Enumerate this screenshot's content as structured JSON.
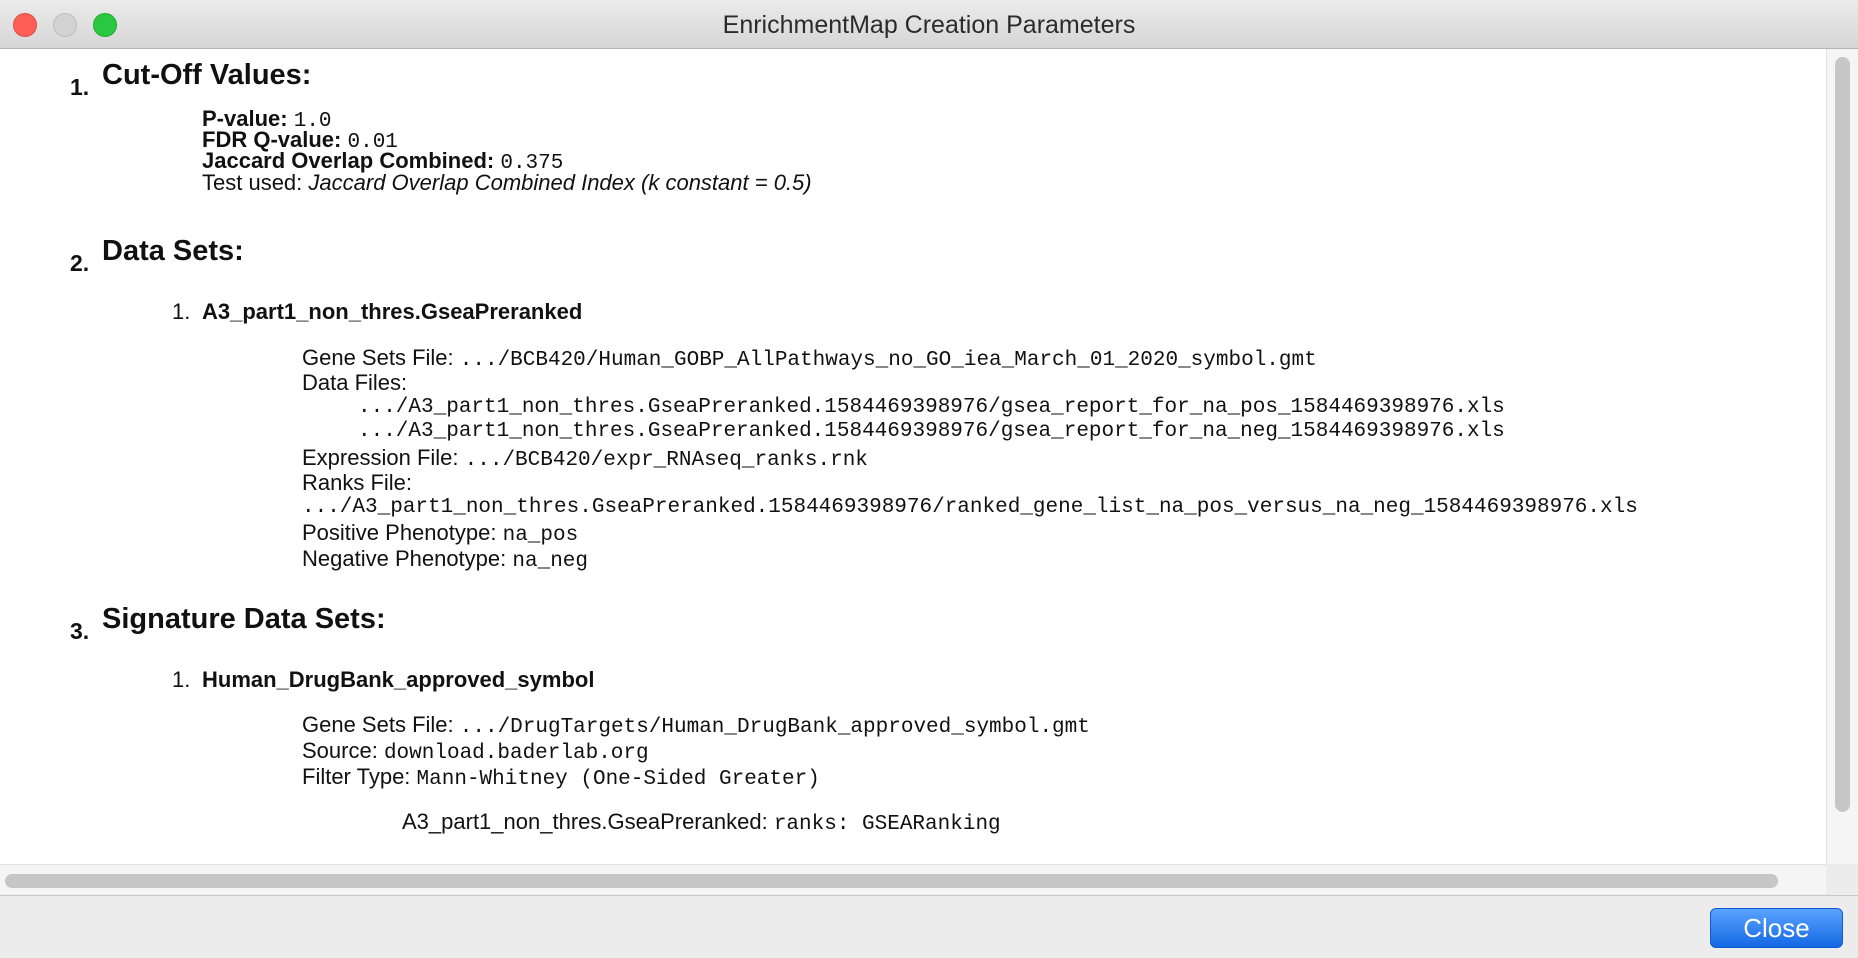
{
  "window": {
    "title": "EnrichmentMap Creation Parameters",
    "buttons": {
      "close_glyph": "×",
      "minimize_glyph": "−",
      "maximize_glyph": "+"
    }
  },
  "sections": {
    "cutoff": {
      "number": "1.",
      "title": "Cut-Off Values:",
      "pvalue_label": "P-value:",
      "pvalue": "1.0",
      "fdr_label": "FDR Q-value:",
      "fdr": "0.01",
      "jaccard_label": "Jaccard Overlap Combined:",
      "jaccard": "0.375",
      "test_label": "Test used:",
      "test_value": "Jaccard Overlap Combined Index (k constant = 0.5)"
    },
    "datasets": {
      "number": "2.",
      "title": "Data Sets:",
      "item": {
        "number": "1.",
        "name": "A3_part1_non_thres.GseaPreranked",
        "gene_sets_label": "Gene Sets File:",
        "gene_sets_file": ".../BCB420/Human_GOBP_AllPathways_no_GO_iea_March_01_2020_symbol.gmt",
        "data_files_label": "Data Files:",
        "data_files": [
          ".../A3_part1_non_thres.GseaPreranked.1584469398976/gsea_report_for_na_pos_1584469398976.xls",
          ".../A3_part1_non_thres.GseaPreranked.1584469398976/gsea_report_for_na_neg_1584469398976.xls"
        ],
        "expression_label": "Expression File:",
        "expression_file": ".../BCB420/expr_RNAseq_ranks.rnk",
        "ranks_label": "Ranks File:",
        "ranks_file": ".../A3_part1_non_thres.GseaPreranked.1584469398976/ranked_gene_list_na_pos_versus_na_neg_1584469398976.xls",
        "positive_label": "Positive Phenotype:",
        "positive_value": "na_pos",
        "negative_label": "Negative Phenotype:",
        "negative_value": "na_neg"
      }
    },
    "signature": {
      "number": "3.",
      "title": "Signature Data Sets:",
      "item": {
        "number": "1.",
        "name": "Human_DrugBank_approved_symbol",
        "gene_sets_label": "Gene Sets File:",
        "gene_sets_file": ".../DrugTargets/Human_DrugBank_approved_symbol.gmt",
        "source_label": "Source:",
        "source_value": "download.baderlab.org",
        "filter_label": "Filter Type:",
        "filter_value": "Mann-Whitney (One-Sided Greater)",
        "ranking_label": "A3_part1_non_thres.GseaPreranked:",
        "ranking_value": "ranks: GSEARanking"
      }
    }
  },
  "footer": {
    "close_label": "Close"
  },
  "colors": {
    "close_button": "#1a73e8",
    "traffic_close": "#fd5f57",
    "traffic_max": "#29c840"
  }
}
